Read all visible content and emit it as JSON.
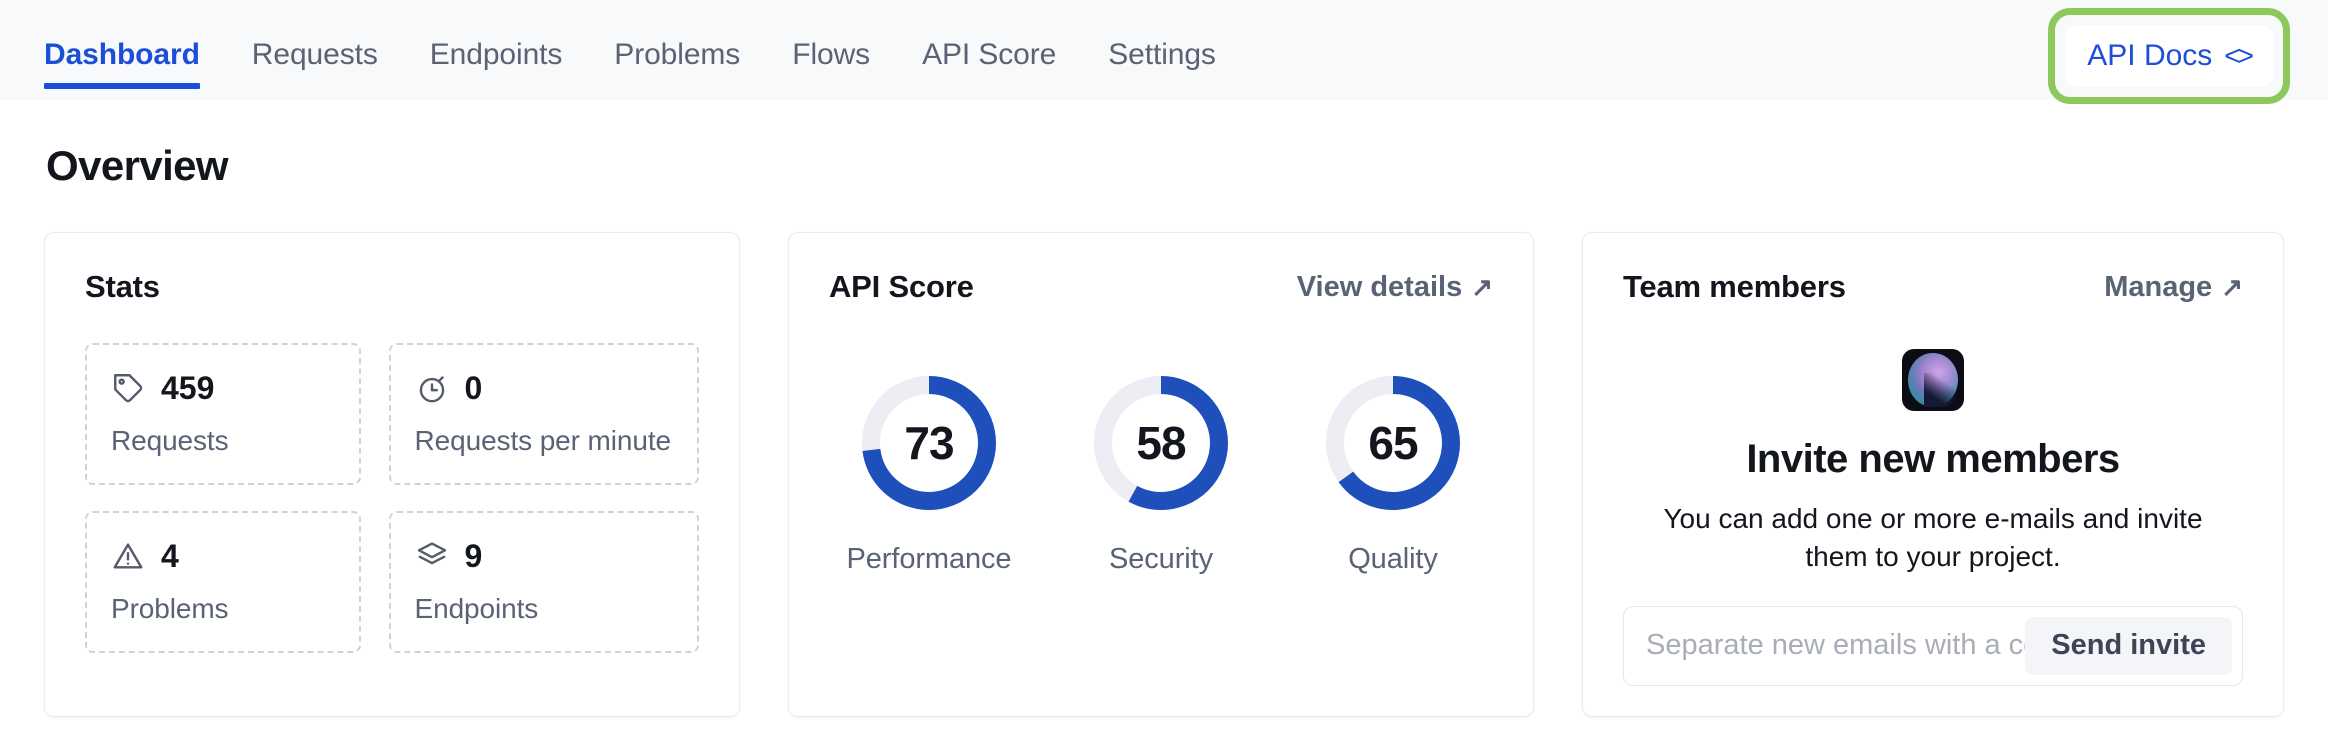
{
  "header": {
    "tabs": [
      {
        "label": "Dashboard",
        "active": true
      },
      {
        "label": "Requests",
        "active": false
      },
      {
        "label": "Endpoints",
        "active": false
      },
      {
        "label": "Problems",
        "active": false
      },
      {
        "label": "Flows",
        "active": false
      },
      {
        "label": "API Score",
        "active": false
      },
      {
        "label": "Settings",
        "active": false
      }
    ],
    "api_docs": {
      "label": "API Docs",
      "icon": "code-brackets-icon",
      "glyph": "<>",
      "highlight_color": "#8cc85a"
    },
    "active_color": "#1d4ed8",
    "inactive_color": "#5a6275",
    "background": "#f8f9fb"
  },
  "page_title": "Overview",
  "cards": {
    "stats": {
      "title": "Stats",
      "items": [
        {
          "icon": "tag-icon",
          "value": "459",
          "label": "Requests"
        },
        {
          "icon": "stopwatch-icon",
          "value": "0",
          "label": "Requests per minute"
        },
        {
          "icon": "warning-triangle-icon",
          "value": "4",
          "label": "Problems"
        },
        {
          "icon": "layers-icon",
          "value": "9",
          "label": "Endpoints"
        }
      ]
    },
    "api_score": {
      "title": "API Score",
      "link_label": "View details",
      "link_icon": "arrow-up-right-icon",
      "track_color": "#eceef4",
      "fill_color": "#1e4fbb"
    },
    "team_members": {
      "title": "Team members",
      "link_label": "Manage",
      "link_icon": "arrow-up-right-icon",
      "avatar": "user-avatar",
      "invite_title": "Invite new members",
      "invite_description": "You can add one or more e-mails and invite them to your project.",
      "email_placeholder": "Separate new emails with a comma",
      "email_value": "",
      "send_label": "Send invite"
    }
  },
  "chart_data": {
    "type": "pie",
    "title": "API Score",
    "subtitle": "",
    "max": 100,
    "track_color": "#eceef4",
    "fill_color": "#1e4fbb",
    "categories": [
      "Performance",
      "Security",
      "Quality"
    ],
    "values": [
      73,
      58,
      65
    ],
    "series": [
      {
        "name": "Performance",
        "value": 73
      },
      {
        "name": "Security",
        "value": 58
      },
      {
        "name": "Quality",
        "value": 65
      }
    ],
    "xlabel": "",
    "ylabel": "",
    "legend": "none",
    "grid": false
  }
}
